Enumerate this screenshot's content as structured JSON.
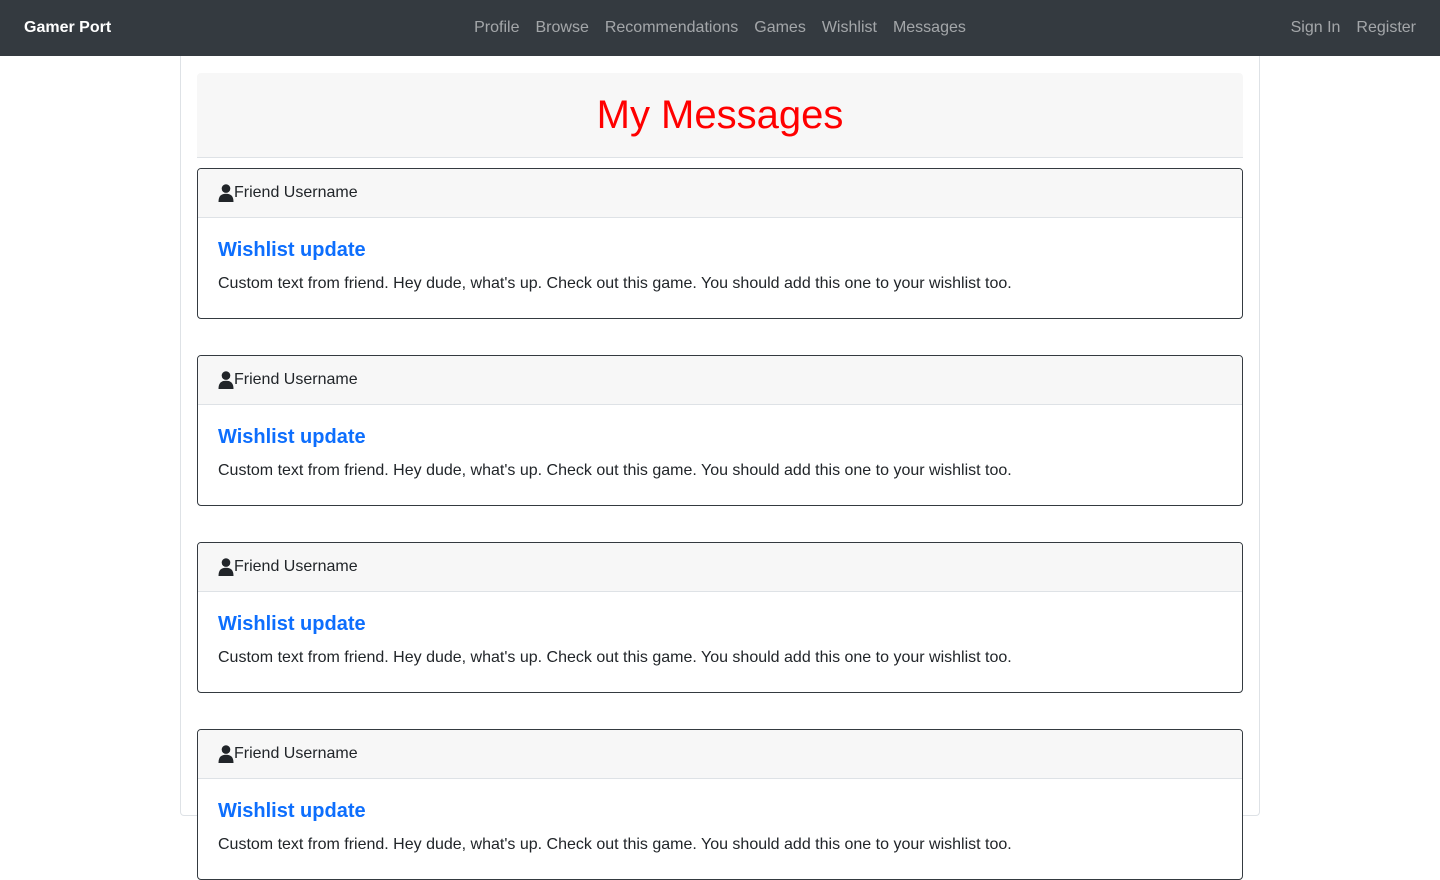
{
  "navbar": {
    "brand": "Gamer Port",
    "links": [
      "Profile",
      "Browse",
      "Recommendations",
      "Games",
      "Wishlist",
      "Messages"
    ],
    "auth_links": [
      "Sign In",
      "Register"
    ]
  },
  "page": {
    "title": "My Messages"
  },
  "messages": [
    {
      "sender": "Friend Username",
      "title": "Wishlist update",
      "text": "Custom text from friend. Hey dude, what's up. Check out this game. You should add this one to your wishlist too."
    },
    {
      "sender": "Friend Username",
      "title": "Wishlist update",
      "text": "Custom text from friend. Hey dude, what's up. Check out this game. You should add this one to your wishlist too."
    },
    {
      "sender": "Friend Username",
      "title": "Wishlist update",
      "text": "Custom text from friend. Hey dude, what's up. Check out this game. You should add this one to your wishlist too."
    },
    {
      "sender": "Friend Username",
      "title": "Wishlist update",
      "text": "Custom text from friend. Hey dude, what's up. Check out this game. You should add this one to your wishlist too."
    }
  ],
  "icons": {
    "sender": "user-icon"
  },
  "colors": {
    "navbar_bg": "#343a40",
    "title_red": "#ff0000",
    "link_blue": "#0d6efd"
  }
}
